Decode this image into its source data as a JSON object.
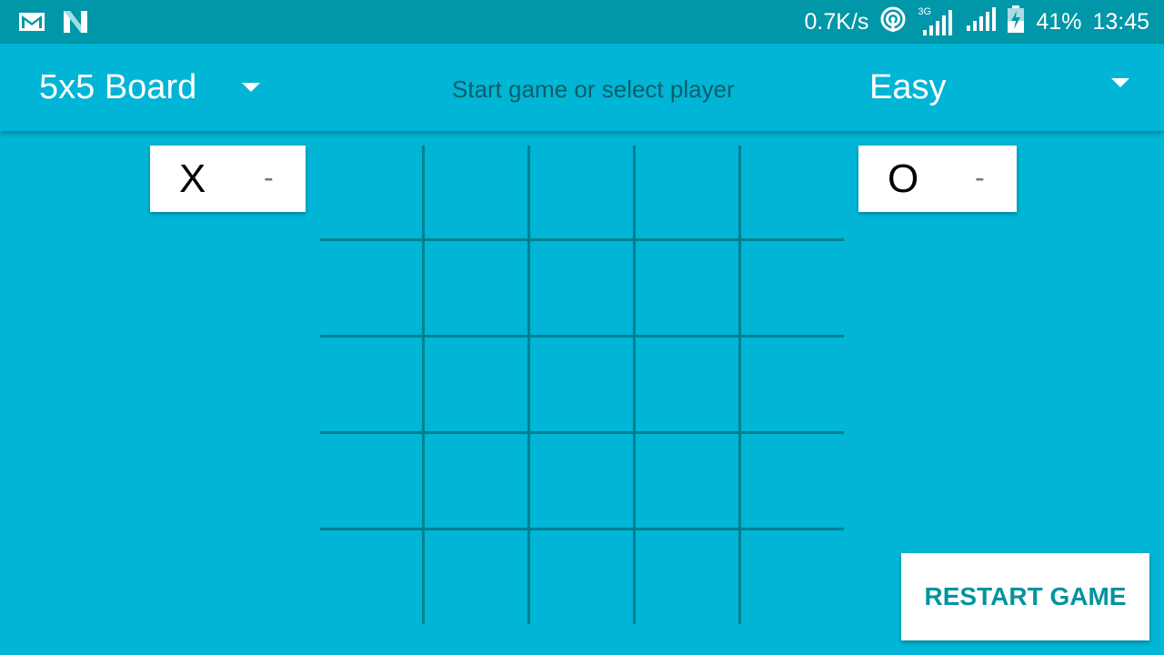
{
  "status_bar": {
    "network_speed": "0.7K/s",
    "network_type": "3G",
    "battery": "41%",
    "time": "13:45",
    "icons": [
      "gmail-icon",
      "n-app-icon",
      "hotspot-icon",
      "signal-icon",
      "signal-icon-2",
      "battery-icon"
    ]
  },
  "toolbar": {
    "board_size": "5x5 Board",
    "status_message": "Start game or select player",
    "difficulty": "Easy"
  },
  "scores": {
    "x": {
      "symbol": "X",
      "value": "-"
    },
    "o": {
      "symbol": "O",
      "value": "-"
    }
  },
  "board": {
    "rows": 5,
    "cols": 5,
    "cells": [
      [
        "",
        "",
        "",
        "",
        ""
      ],
      [
        "",
        "",
        "",
        "",
        ""
      ],
      [
        "",
        "",
        "",
        "",
        ""
      ],
      [
        "",
        "",
        "",
        "",
        ""
      ],
      [
        "",
        "",
        "",
        "",
        ""
      ]
    ]
  },
  "actions": {
    "restart_label": "RESTART GAME"
  },
  "colors": {
    "background": "#00B5D5",
    "status_bar": "#0097A8",
    "grid_line": "#00808F",
    "restart_text": "#00949F"
  }
}
